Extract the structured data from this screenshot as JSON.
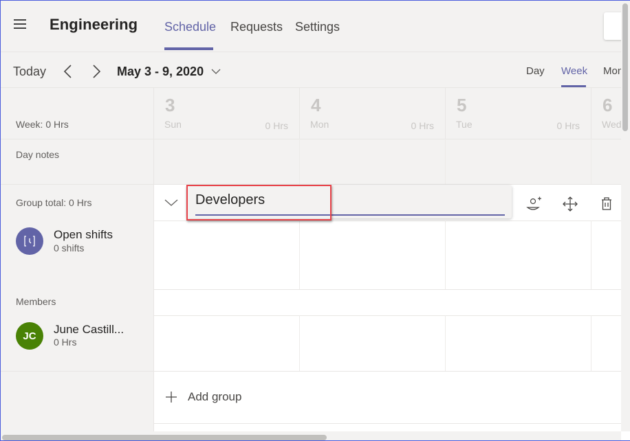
{
  "header": {
    "menu_icon": "hamburger-icon",
    "team_name": "Engineering",
    "tabs": [
      {
        "label": "Schedule",
        "active": true
      },
      {
        "label": "Requests",
        "active": false
      },
      {
        "label": "Settings",
        "active": false
      }
    ]
  },
  "toolbar": {
    "today_label": "Today",
    "prev_icon": "chevron-left-icon",
    "next_icon": "chevron-right-icon",
    "date_range": "May 3 - 9, 2020",
    "date_dropdown_icon": "chevron-down-icon",
    "views": [
      {
        "label": "Day",
        "active": false
      },
      {
        "label": "Week",
        "active": true
      },
      {
        "label": "Month",
        "active": false
      }
    ]
  },
  "summary": {
    "week_total": "Week: 0 Hrs",
    "day_notes_label": "Day notes"
  },
  "days": [
    {
      "num": "3",
      "name": "Sun",
      "hrs": "0 Hrs"
    },
    {
      "num": "4",
      "name": "Mon",
      "hrs": "0 Hrs"
    },
    {
      "num": "5",
      "name": "Tue",
      "hrs": "0 Hrs"
    },
    {
      "num": "6",
      "name": "Wed",
      "hrs": ""
    }
  ],
  "group": {
    "total": "Group total: 0 Hrs",
    "name_value": "Developers",
    "actions": [
      {
        "name": "add-member",
        "icon": "add-person-icon"
      },
      {
        "name": "move",
        "icon": "move-arrows-icon"
      },
      {
        "name": "delete",
        "icon": "trash-icon"
      }
    ],
    "open_shifts": {
      "title": "Open shifts",
      "subtitle": "0 shifts",
      "color": "#6264a7"
    },
    "members_label": "Members",
    "members": [
      {
        "initials": "JC",
        "name": "June Castill...",
        "hours": "0 Hrs",
        "color": "#498205"
      }
    ]
  },
  "add_group_label": "Add group",
  "colors": {
    "accent": "#6264a7",
    "highlight": "#e8434a",
    "background": "#f3f2f1"
  }
}
